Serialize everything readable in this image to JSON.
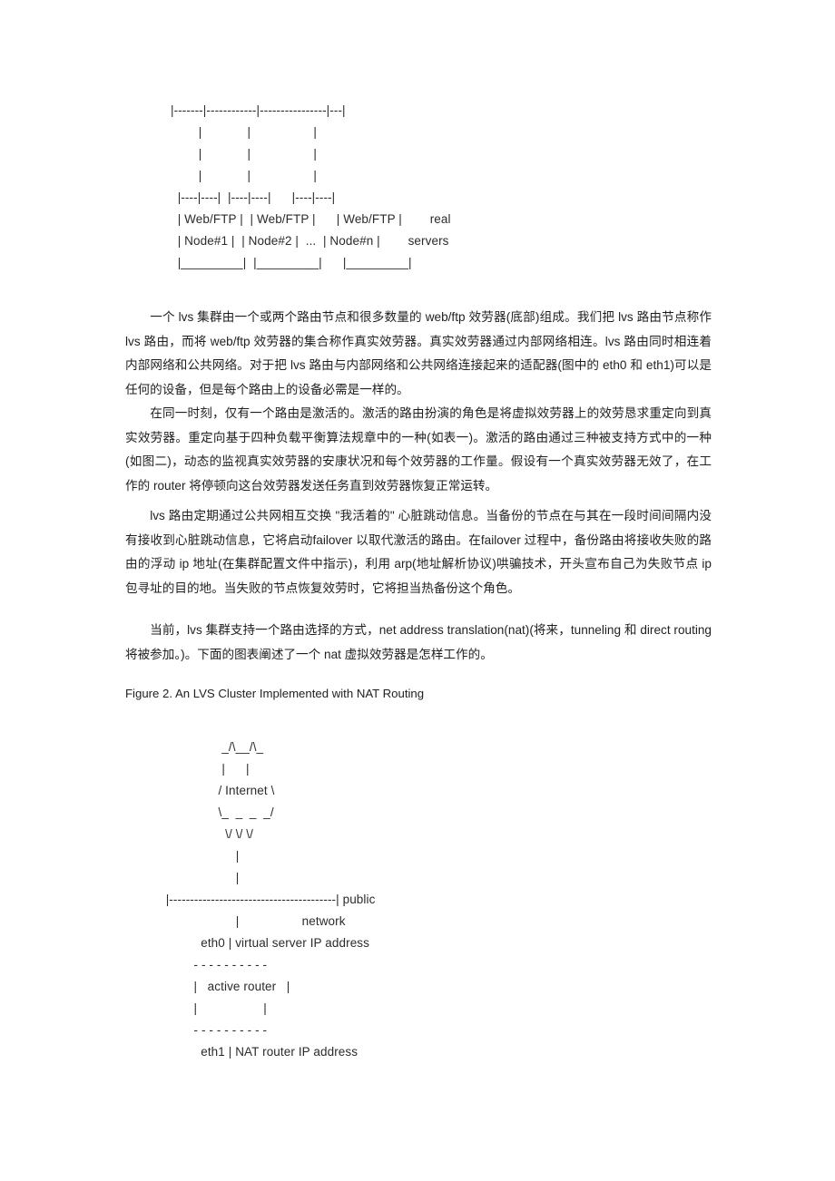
{
  "document": {
    "background_color": "#ffffff",
    "text_color": "#1f1f1f",
    "ascii_color": "#2b2b2b"
  },
  "diagram_one": {
    "name": "lvs-real-servers-ascii-diagram",
    "art": "|-------|------------|----------------|---|\n        |             |                  |\n        |             |                  |\n        |             |                  |\n  |----|----|  |----|----|      |----|----|\n  | Web/FTP |  | Web/FTP |      | Web/FTP |        real\n  | Node#1 |  | Node#2 |  ...  | Node#n |        servers\n  |_________|  |_________|      |_________|"
  },
  "paragraphs": {
    "p1": "一个 lvs 集群由一个或两个路由节点和很多数量的 web/ftp 效劳器(底部)组成。我们把 lvs 路由节点称作 lvs 路由，而将 web/ftp 效劳器的集合称作真实效劳器。真实效劳器通过内部网络相连。lvs 路由同时相连着内部网络和公共网络。对于把 lvs 路由与内部网络和公共网络连接起来的适配器(图中的 eth0 和 eth1)可以是任何的设备，但是每个路由上的设备必需是一样的。",
    "p2": "在同一时刻，仅有一个路由是激活的。激活的路由扮演的角色是将虚拟效劳器上的效劳恳求重定向到真实效劳器。重定向基于四种负载平衡算法规章中的一种(如表一)。激活的路由通过三种被支持方式中的一种(如图二)，动态的监视真实效劳器的安康状况和每个效劳器的工作量。假设有一个真实效劳器无效了，在工作的 router 将停顿向这台效劳器发送任务直到效劳器恢复正常运转。",
    "p3": "lvs 路由定期通过公共网相互交换 \"我活着的\" 心脏跳动信息。当备份的节点在与其在一段时间间隔内没有接收到心脏跳动信息，它将启动failover 以取代激活的路由。在failover 过程中，备份路由将接收失败的路由的浮动 ip 地址(在集群配置文件中指示)，利用 arp(地址解析协议)哄骗技术，开头宣布自己为失败节点 ip 包寻址的目的地。当失败的节点恢复效劳时，它将担当热备份这个角色。",
    "p4": "当前，lvs 集群支持一个路由选择的方式，net address translation(nat)(将来，tunneling 和 direct routing 将被参加。)。下面的图表阐述了一个 nat 虚拟效劳器是怎样工作的。"
  },
  "figure_caption": {
    "text": "Figure 2. An LVS Cluster Implemented with NAT Routing"
  },
  "diagram_two": {
    "name": "nat-routing-ascii-diagram",
    "art": "                  _/\\__/\\_\n                  |      |\n                 / Internet \\\n                 \\_  _  _  _/\n                   \\/ \\/ \\/\n                      |\n                      |\n  |----------------------------------------| public\n                      |                  network\n            eth0 | virtual server IP address\n          - - - - - - - - - -\n          |   active router   |\n          |                   |\n          - - - - - - - - - -\n            eth1 | NAT router IP address"
  }
}
